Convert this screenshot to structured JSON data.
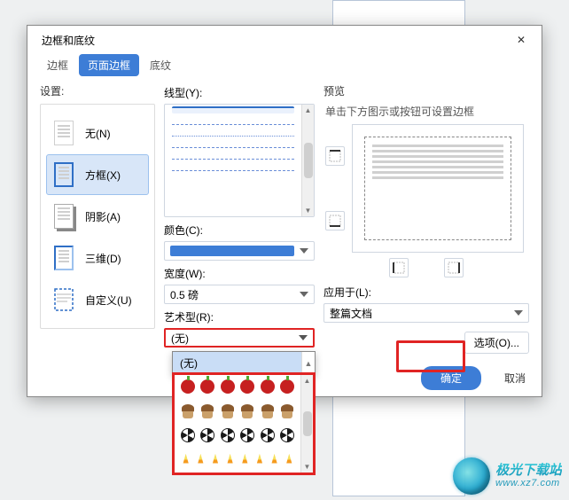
{
  "dialog": {
    "title": "边框和底纹",
    "close": "✕",
    "tabs": {
      "border": "边框",
      "pageBorder": "页面边框",
      "shading": "底纹"
    },
    "settings": {
      "label": "设置:",
      "none": "无(N)",
      "box": "方框(X)",
      "shadow": "阴影(A)",
      "threeD": "三维(D)",
      "custom": "自定义(U)"
    },
    "style": {
      "label": "线型(Y):"
    },
    "color": {
      "label": "颜色(C):"
    },
    "width": {
      "label": "宽度(W):",
      "value": "0.5 磅"
    },
    "art": {
      "label": "艺术型(R):",
      "value": "(无)"
    },
    "preview": {
      "label": "预览",
      "hint": "单击下方图示或按钮可设置边框"
    },
    "applyTo": {
      "label": "应用于(L):",
      "value": "整篇文档"
    },
    "options": "选项(O)...",
    "ok": "确定",
    "cancel": "取消",
    "artDropdown": {
      "noneLabel": "(无)"
    }
  },
  "watermark": {
    "cn": "极光下载站",
    "en": "www.xz7.com"
  }
}
